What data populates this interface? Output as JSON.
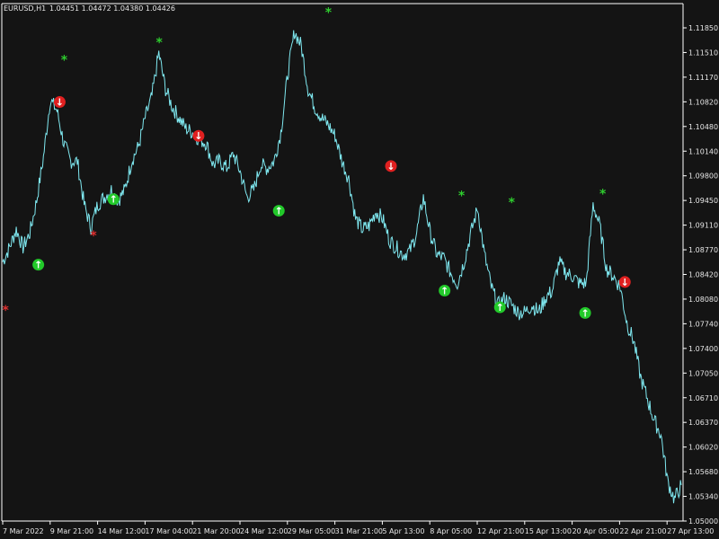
{
  "header": {
    "symbol": "EURUSD,H1",
    "quotes": "1.04451 1.04472 1.04380 1.04426"
  },
  "colors": {
    "background": "#141414",
    "price_line": "#7fe8f0",
    "axis": "#ffffff",
    "text": "#e6e6e6",
    "buy_arrow": "#22c92a",
    "sell_arrow": "#e02020",
    "star_green": "#2ecc2e",
    "star_red": "#e03030"
  },
  "chart_data": {
    "type": "line",
    "price_axis": {
      "min": 1.0505,
      "max": 1.1195,
      "ticks": [
        "1.11850",
        "1.11510",
        "1.11170",
        "1.10820",
        "1.10480",
        "1.10140",
        "1.09800",
        "1.09450",
        "1.09110",
        "1.08770",
        "1.08420",
        "1.08080",
        "1.07740",
        "1.07400",
        "1.07050",
        "1.06710",
        "1.06370",
        "1.06020",
        "1.05680",
        "1.05340",
        "1.05000"
      ]
    },
    "time_axis": {
      "ticks": [
        "7 Mar 2022",
        "9 Mar 21:00",
        "14 Mar 12:00",
        "17 Mar 04:00",
        "21 Mar 20:00",
        "24 Mar 12:00",
        "29 Mar 05:00",
        "31 Mar 21:00",
        "5 Apr 13:00",
        "8 Apr 05:00",
        "12 Apr 21:00",
        "15 Apr 13:00",
        "20 Apr 05:00",
        "22 Apr 21:00",
        "27 Apr 13:00"
      ]
    },
    "series": [
      {
        "values": [
          1.086,
          1.088,
          1.0905,
          1.088,
          1.09,
          1.0945,
          1.1005,
          1.1085,
          1.107,
          1.1025,
          1.1,
          1.1,
          1.094,
          1.0908,
          1.094,
          1.095,
          1.096,
          1.0945,
          1.096,
          1.1,
          1.102,
          1.106,
          1.109,
          1.115,
          1.11,
          1.1075,
          1.106,
          1.1045,
          1.104,
          1.103,
          1.1025,
          1.0995,
          1.1,
          1.099,
          1.101,
          1.0985,
          1.095,
          1.096,
          1.0995,
          1.099,
          1.1,
          1.104,
          1.112,
          1.118,
          1.116,
          1.11,
          1.1075,
          1.106,
          1.105,
          1.1035,
          1.1,
          1.0975,
          1.092,
          1.0905,
          1.091,
          1.093,
          1.092,
          1.089,
          1.088,
          1.087,
          1.0875,
          1.09,
          1.095,
          1.09,
          1.087,
          1.0865,
          1.0845,
          1.083,
          1.086,
          1.09,
          1.0935,
          1.087,
          1.0825,
          1.08,
          1.081,
          1.08,
          1.079,
          1.079,
          1.08,
          1.079,
          1.081,
          1.082,
          1.086,
          1.0845,
          1.084,
          1.083,
          1.083,
          1.094,
          1.091,
          1.085,
          1.084,
          1.0825,
          1.0775,
          1.075,
          1.07,
          1.067,
          1.064,
          1.062,
          1.0555,
          1.053,
          1.055
        ]
      }
    ]
  },
  "markers": [
    {
      "kind": "buy",
      "label": "↑",
      "price": 1.0856,
      "t": 0.0525
    },
    {
      "kind": "sell",
      "label": "↓",
      "price": 1.1082,
      "t": 0.084
    },
    {
      "kind": "buy",
      "label": "↑",
      "price": 1.0947,
      "t": 0.1632
    },
    {
      "kind": "sell",
      "label": "↓",
      "price": 1.1035,
      "t": 0.2886
    },
    {
      "kind": "buy",
      "label": "↑",
      "price": 1.0931,
      "t": 0.4069
    },
    {
      "kind": "sell",
      "label": "↓",
      "price": 1.0993,
      "t": 0.5722
    },
    {
      "kind": "buy",
      "label": "↑",
      "price": 1.082,
      "t": 0.6512
    },
    {
      "kind": "buy",
      "label": "↑",
      "price": 1.0797,
      "t": 0.7328
    },
    {
      "kind": "buy",
      "label": "↑",
      "price": 1.0789,
      "t": 0.8584
    },
    {
      "kind": "sell",
      "label": "↓",
      "price": 1.0832,
      "t": 0.9169
    }
  ],
  "stars": [
    {
      "color": "red",
      "label": "*",
      "price": 1.0793,
      "t": 0.0042
    },
    {
      "color": "green",
      "label": "*",
      "price": 1.1141,
      "t": 0.0906
    },
    {
      "color": "red",
      "label": "*",
      "price": 1.0897,
      "t": 0.1338
    },
    {
      "color": "green",
      "label": "*",
      "price": 1.1165,
      "t": 0.2307
    },
    {
      "color": "green",
      "label": "*",
      "price": 1.1207,
      "t": 0.48
    },
    {
      "color": "green",
      "label": "*",
      "price": 1.0952,
      "t": 0.6762
    },
    {
      "color": "green",
      "label": "*",
      "price": 1.0943,
      "t": 0.75
    },
    {
      "color": "green",
      "label": "*",
      "price": 1.0955,
      "t": 0.8844
    }
  ]
}
